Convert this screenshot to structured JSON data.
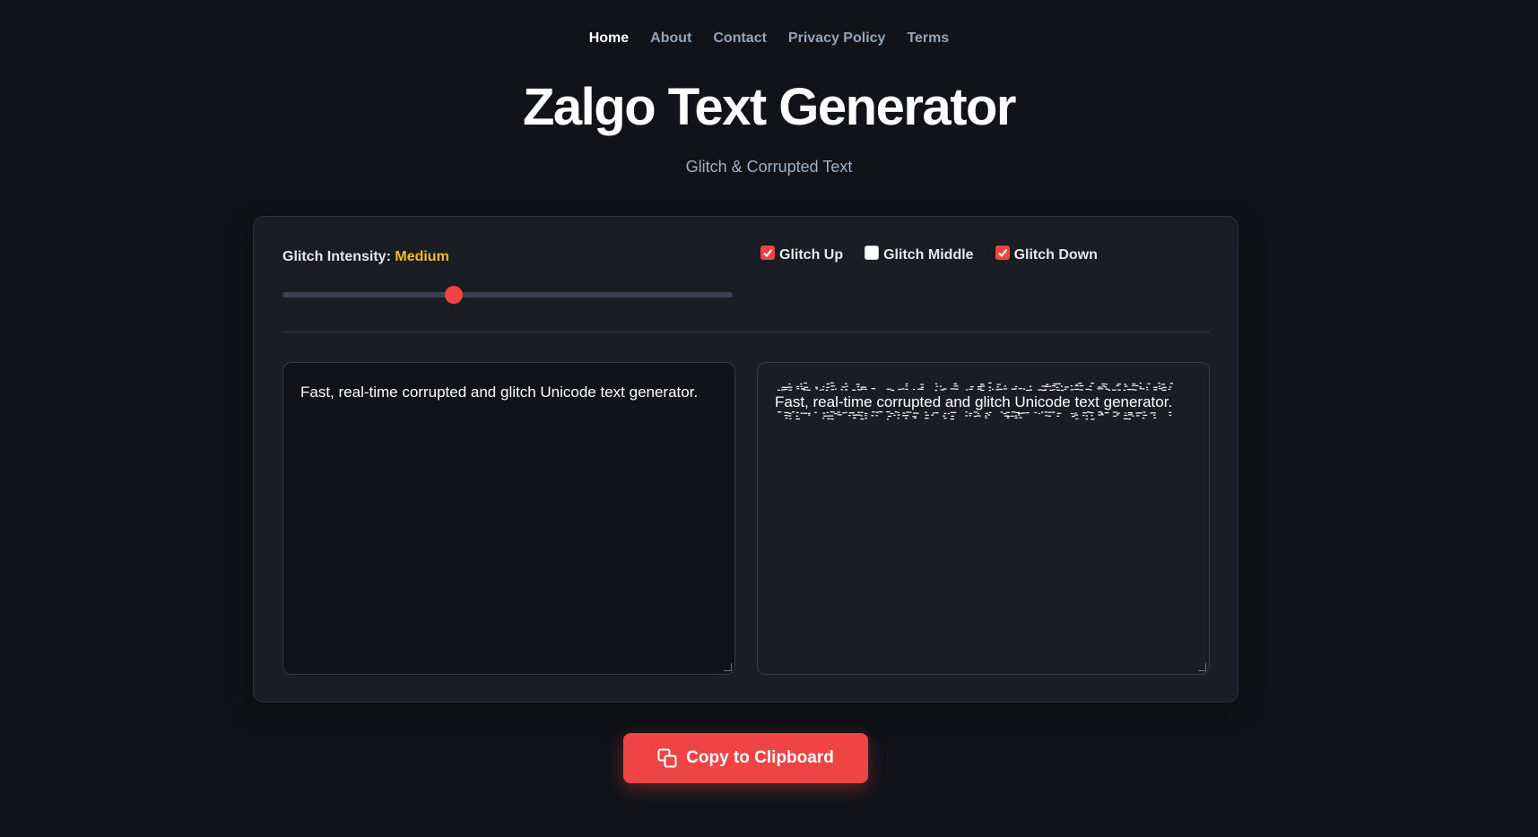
{
  "nav": {
    "items": [
      {
        "label": "Home",
        "active": true
      },
      {
        "label": "About",
        "active": false
      },
      {
        "label": "Contact",
        "active": false
      },
      {
        "label": "Privacy Policy",
        "active": false
      },
      {
        "label": "Terms",
        "active": false
      }
    ]
  },
  "header": {
    "title": "Zalgo Text Generator",
    "subtitle": "Glitch & Corrupted Text"
  },
  "controls": {
    "intensity_label": "Glitch Intensity:",
    "intensity_value": "Medium",
    "intensity_level": 0.38,
    "checkboxes": [
      {
        "label": "Glitch Up",
        "checked": true
      },
      {
        "label": "Glitch Middle",
        "checked": false
      },
      {
        "label": "Glitch Down",
        "checked": true
      }
    ]
  },
  "input": {
    "value": "Fast, real-time corrupted and glitch Unicode text generator."
  },
  "output": {
    "value": "Fast, real-time corrupted and glitch Unicode text generator."
  },
  "copy_button": {
    "label": "Copy to Clipboard",
    "icon": "copy-icon"
  },
  "colors": {
    "background": "#111318",
    "panel": "#1a1d24",
    "accent": "#ef4444",
    "intensity_value": "#f5b82e",
    "nav_inactive": "#94a3b8",
    "subtitle": "#9fb0c8"
  }
}
